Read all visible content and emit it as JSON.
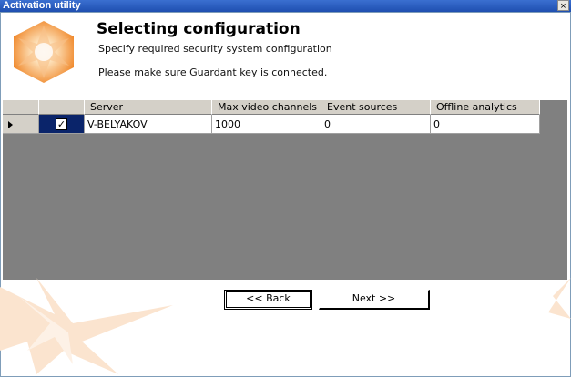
{
  "window": {
    "title": "Activation utility",
    "close_glyph": "×"
  },
  "header": {
    "title": "Selecting configuration",
    "subtitle": "Specify required security system configuration",
    "notice": "Please make sure Guardant key is connected.",
    "logo_icon": "orange-star-logo-icon"
  },
  "table": {
    "columns": [
      "",
      "",
      "Server",
      "Max video channels",
      "Event sources",
      "Offline analytics"
    ],
    "rows": [
      {
        "selected": true,
        "checked": true,
        "server": "V-BELYAKOV",
        "max_video_channels": "1000",
        "event_sources": "0",
        "offline_analytics": "0"
      }
    ]
  },
  "buttons": {
    "back": "<< Back",
    "next": "Next >>"
  },
  "colors": {
    "accent": "#f5a25a",
    "selection": "#0a246a",
    "grid_bg": "#808080",
    "header_bg": "#d4d0c8"
  }
}
